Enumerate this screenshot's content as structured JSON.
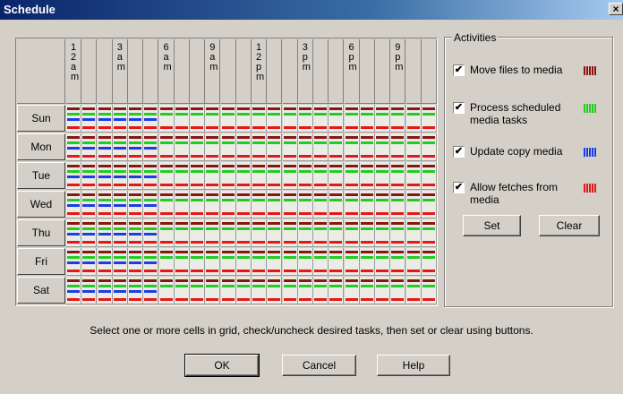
{
  "window": {
    "title": "Schedule",
    "close_glyph": "×"
  },
  "hours": [
    "1\n2\na\nm",
    "",
    "",
    "3\na\nm",
    "",
    "",
    "6\na\nm",
    "",
    "",
    "9\na\nm",
    "",
    "",
    "1\n2\np\nm",
    "",
    "",
    "3\np\nm",
    "",
    "",
    "6\np\nm",
    "",
    "",
    "9\np\nm",
    "",
    ""
  ],
  "days": [
    "Sun",
    "Mon",
    "Tue",
    "Wed",
    "Thu",
    "Fri",
    "Sat"
  ],
  "schedule": {
    "blue_hours_count": 6,
    "legend_colors": {
      "move": "#8b1414",
      "process": "#22cc22",
      "update": "#1e3ce6",
      "fetch": "#e41818"
    }
  },
  "activities": {
    "legend": "Activities",
    "items": [
      {
        "key": "move",
        "label": "Move files to media",
        "checked": true,
        "check_glyph": "✔"
      },
      {
        "key": "process",
        "label": "Process scheduled media tasks",
        "checked": true,
        "check_glyph": "✔"
      },
      {
        "key": "update",
        "label": "Update copy media",
        "checked": true,
        "check_glyph": "✔"
      },
      {
        "key": "fetch",
        "label": "Allow fetches from media",
        "checked": true,
        "check_glyph": "✔"
      }
    ],
    "set_label": "Set",
    "clear_label": "Clear"
  },
  "instruction": "Select one or more cells in grid, check/uncheck desired tasks, then set or clear using buttons.",
  "buttons": {
    "ok": "OK",
    "cancel": "Cancel",
    "help": "Help"
  }
}
